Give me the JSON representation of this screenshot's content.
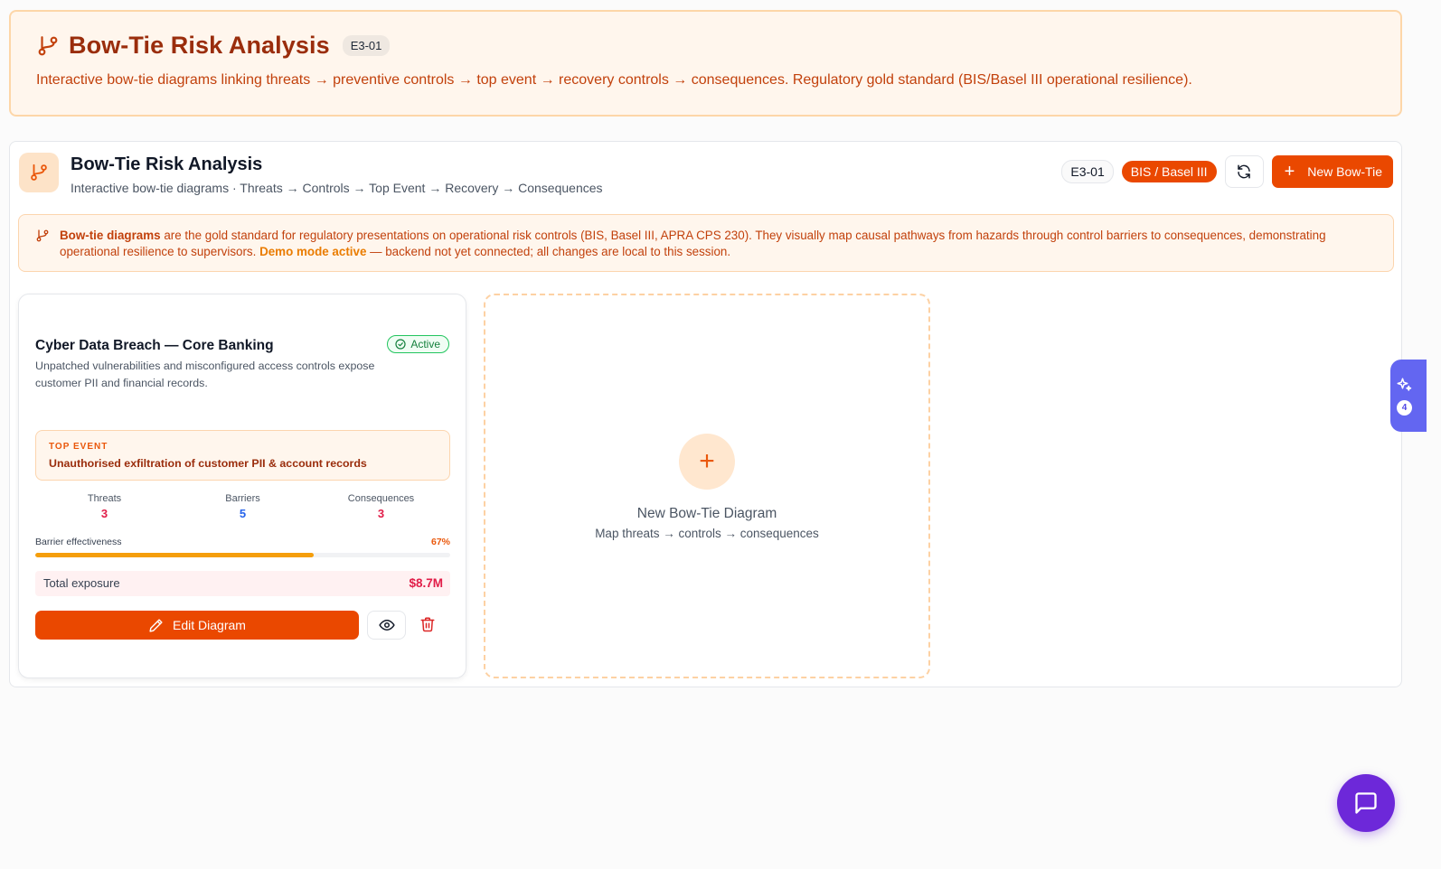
{
  "hero": {
    "title": "Bow-Tie Risk Analysis",
    "badge": "E3-01",
    "description": "Interactive bow-tie diagrams linking threats → preventive controls → top event → recovery controls → consequences. Regulatory gold standard (BIS/Basel III operational resilience)."
  },
  "panel": {
    "title": "Bow-Tie Risk Analysis",
    "subtitle": "Interactive bow-tie diagrams · Threats → Controls → Top Event → Recovery → Consequences",
    "code_pill": "E3-01",
    "standard_pill": "BIS / Basel III",
    "new_button_label": "New Bow-Tie"
  },
  "info": {
    "lead_bold": "Bow-tie diagrams",
    "body": " are the gold standard for regulatory presentations on operational risk controls (BIS, Basel III, APRA CPS 230). They visually map causal pathways from hazards through control barriers to consequences, demonstrating operational resilience to supervisors. ",
    "demo_bold": "Demo mode active",
    "demo_tail": " — backend not yet connected; all changes are local to this session."
  },
  "cards": [
    {
      "title": "Cyber Data Breach — Core Banking",
      "status": "Active",
      "description": "Unpatched vulnerabilities and misconfigured access controls expose customer PII and financial records.",
      "top_event_label": "TOP EVENT",
      "top_event": "Unauthorised exfiltration of customer PII & account records",
      "stats": [
        {
          "label": "Threats",
          "value": "3",
          "color": "#e11d48"
        },
        {
          "label": "Barriers",
          "value": "5",
          "color": "#2563eb"
        },
        {
          "label": "Consequences",
          "value": "3",
          "color": "#e11d48"
        }
      ],
      "barrier_label": "Barrier effectiveness",
      "barrier_pct_text": "67%",
      "barrier_pct": 0.67,
      "exposure_label": "Total exposure",
      "exposure_value": "$8.7M",
      "edit_label": "Edit Diagram"
    }
  ],
  "new_card": {
    "title": "New Bow-Tie Diagram",
    "subtitle": "Map threats → controls → consequences"
  },
  "side_tab": {
    "count": "4"
  },
  "colors": {
    "accent": "#ea4800",
    "brand_dark": "#9a2d0c",
    "warm_bg": "#fff6ed",
    "ai": "#6366f1",
    "chat": "#6d28d9"
  }
}
